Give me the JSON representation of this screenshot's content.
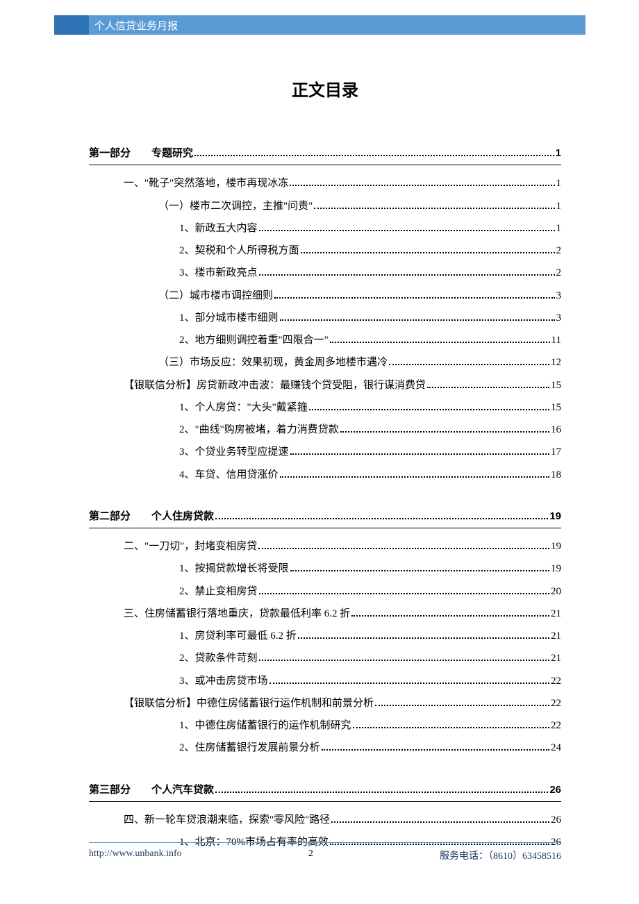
{
  "header": {
    "title": "个人信贷业务月报"
  },
  "toc_title": "正文目录",
  "toc": [
    {
      "type": "part",
      "label": "第一部分　　专题研究",
      "page": "1"
    },
    {
      "type": "l1",
      "label": "一、\"靴子\"突然落地，楼市再现冰冻",
      "page": "1"
    },
    {
      "type": "l2",
      "label": "（一）楼市二次调控，主推\"问责\"",
      "page": "1"
    },
    {
      "type": "l3",
      "label": "1、新政五大内容",
      "page": "1"
    },
    {
      "type": "l3",
      "label": "2、契税和个人所得税方面",
      "page": "2"
    },
    {
      "type": "l3",
      "label": "3、楼市新政亮点",
      "page": "2"
    },
    {
      "type": "l2",
      "label": "（二）城市楼市调控细则",
      "page": "3"
    },
    {
      "type": "l3",
      "label": "1、部分城市楼市细则",
      "page": "3"
    },
    {
      "type": "l3",
      "label": "2、地方细则调控着重\"四限合一\"",
      "page": "11"
    },
    {
      "type": "l2",
      "label": "（三）市场反应：效果初现，黄金周多地楼市遇冷",
      "page": "12"
    },
    {
      "type": "l1",
      "label": "【银联信分析】房贷新政冲击波：最赚钱个贷受阻，银行谋消费贷",
      "page": "15"
    },
    {
      "type": "l3",
      "label": "1、个人房贷：\"大头\"戴紧箍",
      "page": "15"
    },
    {
      "type": "l3",
      "label": "2、\"曲线\"购房被堵，着力消费贷款",
      "page": "16"
    },
    {
      "type": "l3",
      "label": "3、个贷业务转型应提速",
      "page": "17"
    },
    {
      "type": "l3",
      "label": "4、车贷、信用贷涨价",
      "page": "18"
    },
    {
      "type": "part",
      "label": "第二部分　　个人住房贷款",
      "page": "19"
    },
    {
      "type": "l1",
      "label": "二、\"一刀切\"，封堵变相房贷",
      "page": "19"
    },
    {
      "type": "l3",
      "label": "1、按揭贷款增长将受限",
      "page": "19"
    },
    {
      "type": "l3",
      "label": "2、禁止变相房贷",
      "page": "20"
    },
    {
      "type": "l1",
      "label": "三、住房储蓄银行落地重庆，贷款最低利率 6.2 折",
      "page": "21"
    },
    {
      "type": "l3",
      "label": "1、房贷利率可最低 6.2 折",
      "page": "21"
    },
    {
      "type": "l3",
      "label": "2、贷款条件苛刻",
      "page": "21"
    },
    {
      "type": "l3",
      "label": "3、或冲击房贷市场",
      "page": "22"
    },
    {
      "type": "l1",
      "label": "【银联信分析】中德住房储蓄银行运作机制和前景分析",
      "page": "22"
    },
    {
      "type": "l3",
      "label": "1、中德住房储蓄银行的运作机制研究",
      "page": "22"
    },
    {
      "type": "l3",
      "label": "2、住房储蓄银行发展前景分析",
      "page": "24"
    },
    {
      "type": "part",
      "label": "第三部分　　个人汽车贷款",
      "page": "26"
    },
    {
      "type": "l1",
      "label": "四、新一轮车贷浪潮来临，探索\"零风险\"路径",
      "page": "26"
    },
    {
      "type": "l3",
      "label": "1、北京：70%市场占有率的高效",
      "page": "26"
    }
  ],
  "footer": {
    "url": "http://www.unbank.info",
    "page_number": "2",
    "phone_label": "服务电话：",
    "phone_value": "（8610）63458516"
  }
}
